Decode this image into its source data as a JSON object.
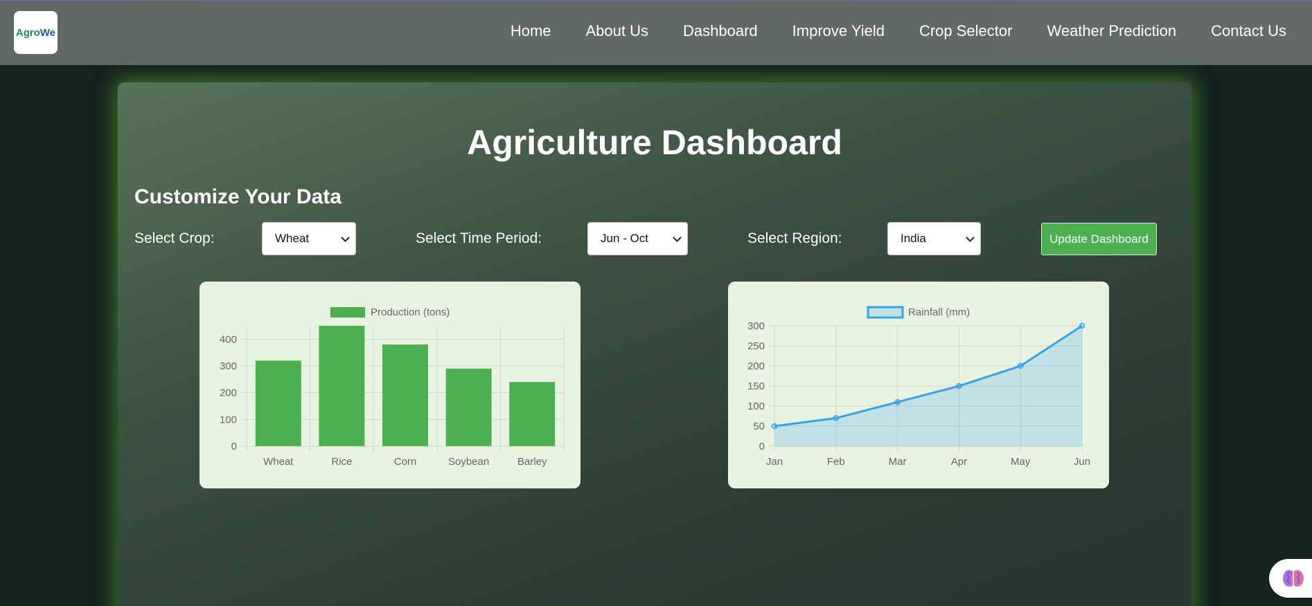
{
  "nav": {
    "logo_agro": "Agro",
    "logo_we": "We",
    "links": [
      "Home",
      "About Us",
      "Dashboard",
      "Improve Yield",
      "Crop Selector",
      "Weather Prediction",
      "Contact Us"
    ]
  },
  "main": {
    "title": "Agriculture Dashboard",
    "section_title": "Customize Your Data",
    "controls": {
      "crop_label": "Select Crop:",
      "crop_value": "Wheat",
      "period_label": "Select Time Period:",
      "period_value": "Jun - Oct",
      "region_label": "Select Region:",
      "region_value": "India",
      "update_button": "Update Dashboard"
    }
  },
  "colors": {
    "bar": "#4caf50",
    "line": "#36a2eb",
    "line_fill": "rgba(54,162,235,0.22)",
    "card": "#e8f3e2",
    "button": "#4caf50"
  },
  "icons": {
    "assistant": "brain-icon"
  },
  "chart_data": [
    {
      "type": "bar",
      "categories": [
        "Wheat",
        "Rice",
        "Corn",
        "Soybean",
        "Barley"
      ],
      "series": [
        {
          "name": "Production (tons)",
          "values": [
            320,
            450,
            380,
            290,
            240
          ]
        }
      ],
      "ylim": [
        0,
        450
      ],
      "yticks": [
        0,
        100,
        200,
        300,
        400
      ],
      "grid": true,
      "legend": "top-center"
    },
    {
      "type": "area",
      "categories": [
        "Jan",
        "Feb",
        "Mar",
        "Apr",
        "May",
        "Jun"
      ],
      "series": [
        {
          "name": "Rainfall (mm)",
          "values": [
            50,
            70,
            110,
            150,
            200,
            300
          ]
        }
      ],
      "ylim": [
        0,
        300
      ],
      "yticks": [
        0,
        50,
        100,
        150,
        200,
        250,
        300
      ],
      "grid": true,
      "legend": "top-center"
    }
  ]
}
